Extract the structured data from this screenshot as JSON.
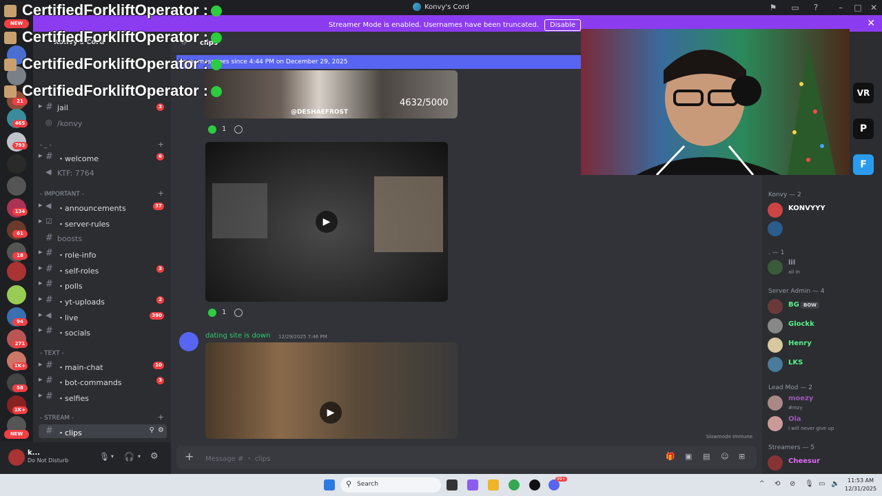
{
  "window": {
    "title": "Konvy's Cord"
  },
  "banner": {
    "message": "Streamer Mode is enabled. Usernames have been truncated.",
    "disable_label": "Disable",
    "close_glyph": "✕"
  },
  "overlay": {
    "repeated_name": "CertifiedForkliftOperator :"
  },
  "server_rail": {
    "badges": [
      "NEW",
      "21",
      "465",
      "793",
      "134",
      "61",
      "18",
      "94",
      "271",
      "1K+",
      "58",
      "1K+",
      "NEW"
    ]
  },
  "server_header": {
    "name": "Konvy's Cord"
  },
  "channels": {
    "top": [
      {
        "name": "jail",
        "count": "3"
      },
      {
        "name": "/konvy"
      }
    ],
    "cat_misc": "- _ - ",
    "misc": [
      {
        "name": "・welcome",
        "count": "6"
      },
      {
        "name": "KTF: 7764"
      }
    ],
    "cat_important": "- IMPORTANT -",
    "important": [
      {
        "name": "・announcements",
        "count": "37"
      },
      {
        "name": "・server-rules"
      },
      {
        "name": "boosts"
      },
      {
        "name": "・role-info"
      },
      {
        "name": "・self-roles",
        "count": "3"
      },
      {
        "name": "・polls"
      },
      {
        "name": "・yt-uploads",
        "count": "2"
      },
      {
        "name": "・live",
        "count": "390"
      },
      {
        "name": "・socials"
      }
    ],
    "cat_text": "- TEXT -",
    "text": [
      {
        "name": "・main-chat",
        "count": "10"
      },
      {
        "name": "・bot-commands",
        "count": "3"
      },
      {
        "name": "・selfies"
      }
    ],
    "cat_stream": "- STREAM -",
    "stream": [
      {
        "name": "・clips"
      }
    ]
  },
  "user_panel": {
    "name": "k...",
    "status": "Do Not Disturb"
  },
  "chat": {
    "channel_name": "clips",
    "new_messages": "new messages since 4:44 PM on December 29, 2025",
    "watermark_handle": "@DESHAEFROST",
    "counter": "4632/5000",
    "reaction_count_1": "1",
    "reaction_count_2": "1",
    "message2": {
      "author": "dating site is down",
      "timestamp": "12/29/2025 7:46 PM"
    },
    "slowmode": "Slowmode Immune",
    "composer_placeholder": "Message # ・ clips"
  },
  "members": {
    "groups": [
      {
        "title": "Konvy — 2",
        "items": [
          {
            "name": "KONVYYY",
            "color": "#ffffff"
          },
          {
            "name": "",
            "color": "#ffffff"
          }
        ]
      },
      {
        "title": ". — 1",
        "items": [
          {
            "name": "lil",
            "sub": "all in",
            "color": "#949ba4"
          }
        ]
      },
      {
        "title": "Server Admin — 4",
        "items": [
          {
            "name": "BG",
            "tag": "BOW",
            "color": "#57f287"
          },
          {
            "name": "Glockk",
            "color": "#57f287"
          },
          {
            "name": "Henry",
            "color": "#57f287"
          },
          {
            "name": "LKS",
            "color": "#57f287"
          }
        ]
      },
      {
        "title": "Lead Mod — 2",
        "items": [
          {
            "name": "moezy",
            "sub": "#mzy",
            "color": "#9b59b6"
          },
          {
            "name": "Ola",
            "sub": "I will never give up",
            "color": "#9b59b6"
          }
        ]
      },
      {
        "title": "Streamers — 5",
        "items": [
          {
            "name": "Cheesur",
            "color": "#e06bf5"
          }
        ]
      }
    ]
  },
  "taskbar": {
    "search": "Search",
    "time": "11:53 AM",
    "date": "12/31/2025",
    "notif_badge": "99+"
  },
  "colors": {
    "accent": "#5865f2",
    "streamer_banner": "#8c3cf0",
    "badge_red": "#f23f43"
  }
}
